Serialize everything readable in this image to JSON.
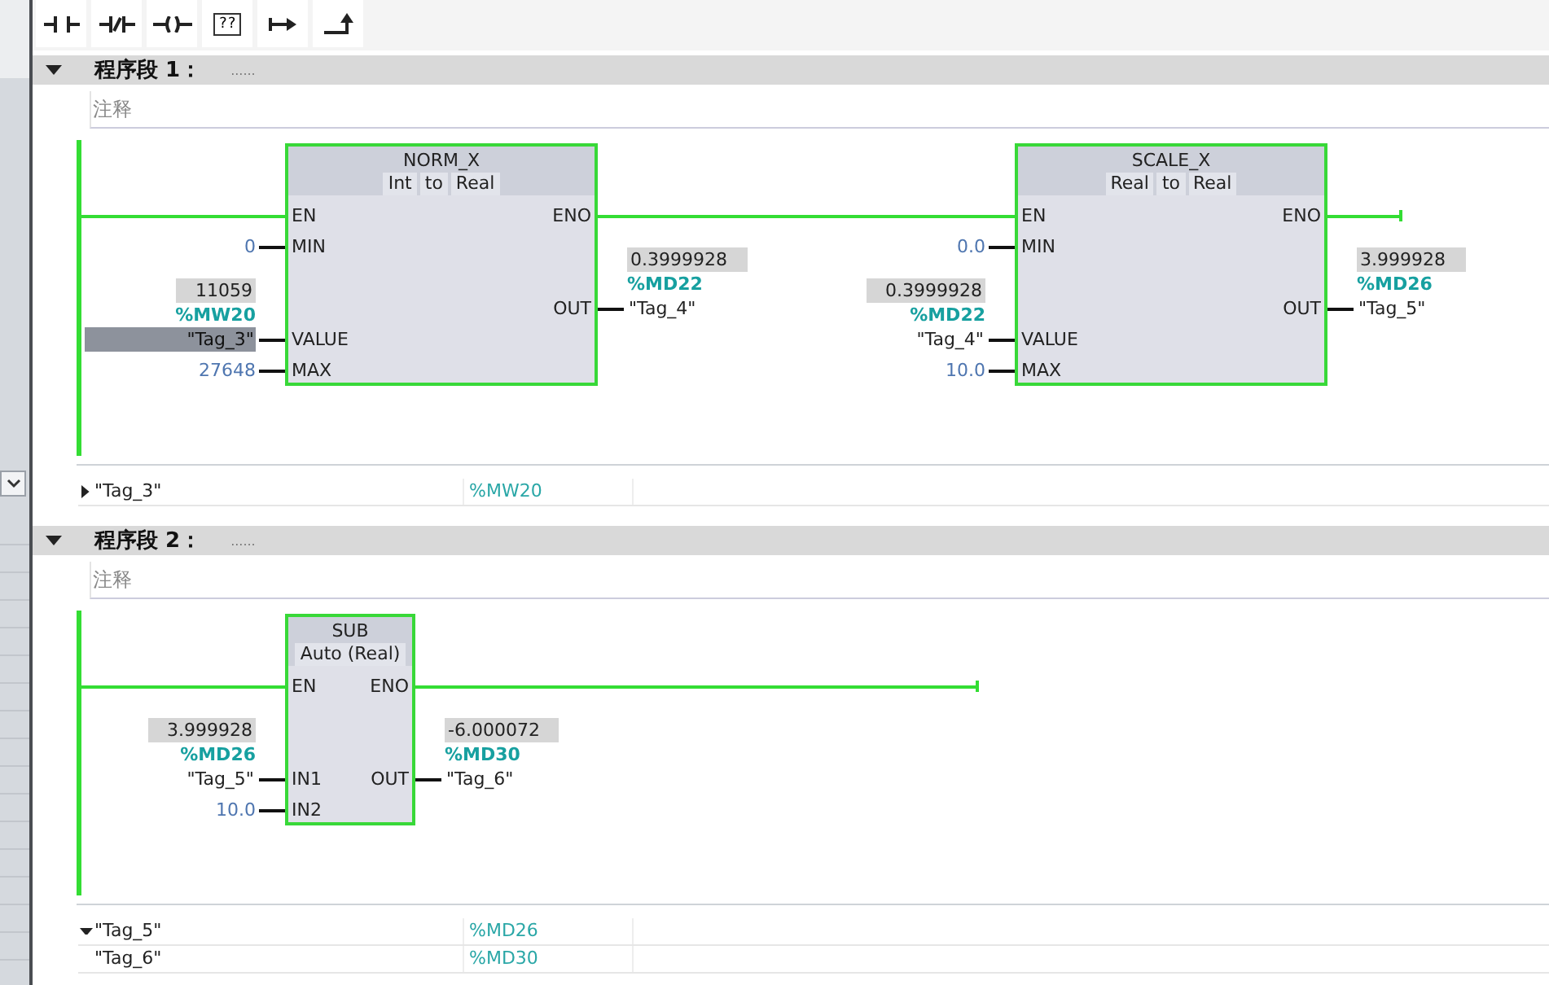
{
  "toolbar": [
    {
      "kind": "contact"
    },
    {
      "kind": "contact_negated"
    },
    {
      "kind": "coil"
    },
    {
      "kind": "box",
      "label": "??"
    },
    {
      "kind": "branch_open"
    },
    {
      "kind": "branch_close"
    }
  ],
  "networks": [
    {
      "title": "程序段 1：",
      "title_note": "......",
      "expanded": true,
      "comment": "注释",
      "blocks": [
        {
          "name": "NORM_X",
          "type_labels": [
            "Int",
            "to",
            "Real"
          ],
          "inputs": [
            {
              "kind": "en",
              "pin": "EN"
            },
            {
              "kind": "constant",
              "pin": "MIN",
              "value": "0"
            },
            {
              "kind": "tag",
              "pin": "VALUE",
              "monitor": "11059",
              "address": "%MW20",
              "tag": "\"Tag_3\"",
              "selected": true
            },
            {
              "kind": "constant",
              "pin": "MAX",
              "value": "27648"
            }
          ],
          "outputs": [
            {
              "kind": "eno",
              "pin": "ENO"
            },
            {
              "kind": "tag",
              "pin": "OUT",
              "monitor": "0.3999928",
              "address": "%MD22",
              "tag": "\"Tag_4\""
            }
          ]
        },
        {
          "name": "SCALE_X",
          "type_labels": [
            "Real",
            "to",
            "Real"
          ],
          "inputs": [
            {
              "kind": "en",
              "pin": "EN"
            },
            {
              "kind": "constant",
              "pin": "MIN",
              "value": "0.0"
            },
            {
              "kind": "tag",
              "pin": "VALUE",
              "monitor": "0.3999928",
              "address": "%MD22",
              "tag": "\"Tag_4\"",
              "selected": false
            },
            {
              "kind": "constant",
              "pin": "MAX",
              "value": "10.0"
            }
          ],
          "outputs": [
            {
              "kind": "eno",
              "pin": "ENO"
            },
            {
              "kind": "tag",
              "pin": "OUT",
              "monitor": "3.999928",
              "address": "%MD26",
              "tag": "\"Tag_5\""
            }
          ]
        }
      ],
      "tag_table": {
        "expanded": false,
        "rows": [
          {
            "name": "\"Tag_3\"",
            "address": "%MW20"
          }
        ]
      }
    },
    {
      "title": "程序段 2：",
      "title_note": "......",
      "expanded": true,
      "comment": "注释",
      "blocks": [
        {
          "name": "SUB",
          "type_labels": [
            "Auto (Real)"
          ],
          "inputs": [
            {
              "kind": "en",
              "pin": "EN"
            },
            {
              "kind": "tag",
              "pin": "IN1",
              "monitor": "3.999928",
              "address": "%MD26",
              "tag": "\"Tag_5\"",
              "selected": false
            },
            {
              "kind": "constant",
              "pin": "IN2",
              "value": "10.0"
            }
          ],
          "outputs": [
            {
              "kind": "eno",
              "pin": "ENO"
            },
            {
              "kind": "tag",
              "pin": "OUT",
              "monitor": "-6.000072",
              "address": "%MD30",
              "tag": "\"Tag_6\""
            }
          ]
        }
      ],
      "tag_table": {
        "expanded": true,
        "rows": [
          {
            "name": "\"Tag_5\"",
            "address": "%MD26"
          },
          {
            "name": "\"Tag_6\"",
            "address": "%MD30"
          }
        ]
      }
    }
  ]
}
